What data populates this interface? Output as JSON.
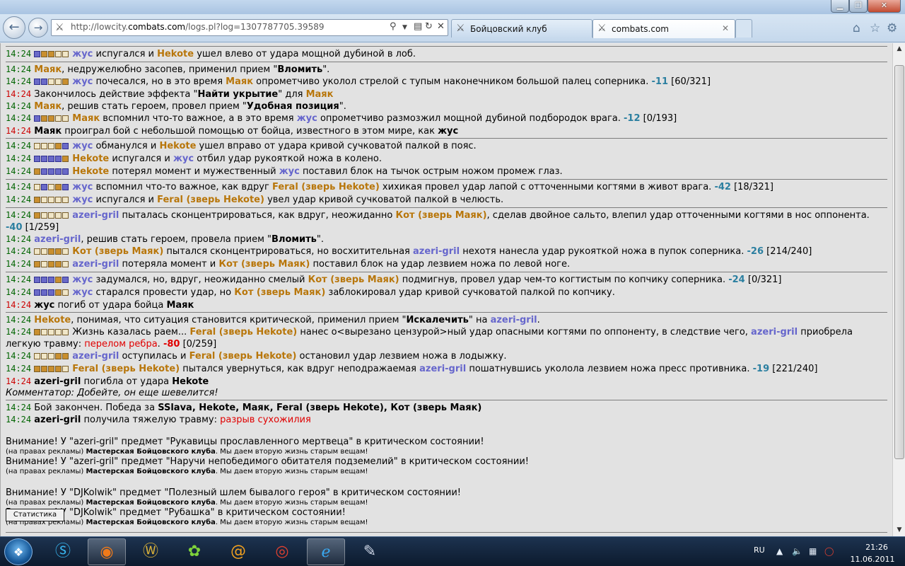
{
  "browser": {
    "url_prefix": "http://lowcity.",
    "url_domain": "combats.com",
    "url_suffix": "/logs.pl?log=1307787705.39589",
    "tabs": [
      {
        "label": "Бойцовский клуб"
      },
      {
        "label": "combats.com"
      }
    ],
    "close_glyph": "✕"
  },
  "log": {
    "l1": {
      "time": "14:24",
      "a": "жус",
      "t1": " испугался и ",
      "b": "Hekote",
      "t2": " ушел влево от удара мощной дубиной в лоб."
    },
    "l2": {
      "time": "14:24",
      "a": "Маяк",
      "t1": ", недружелюбно засопев, применил прием \"",
      "skill": "Вломить",
      "t2": "\"."
    },
    "l3": {
      "time": "14:24",
      "a": "жус",
      "t1": " почесался, но в это время ",
      "b": "Маяк",
      "t2": " опрометчиво уколол стрелой с тупым наконечником большой палец соперника. ",
      "dmg": "-11",
      "hp": " [60/321]"
    },
    "l4": {
      "time": "14:24",
      "t1": "Закончилось действие эффекта \"",
      "skill": "Найти укрытие",
      "t2": "\" для ",
      "a": "Маяк"
    },
    "l5": {
      "time": "14:24",
      "a": "Маяк",
      "t1": ", решив стать героем, провел прием \"",
      "skill": "Удобная позиция",
      "t2": "\"."
    },
    "l6": {
      "time": "14:24",
      "a": "Маяк",
      "t1": " вспомнил что-то важное, а в это время ",
      "b": "жус",
      "t2": " опрометчиво размозжил мощной дубиной подбородок врага. ",
      "dmg": "-12",
      "hp": " [0/193]"
    },
    "l7": {
      "time": "14:24",
      "a": "Маяк",
      "t1": " проиграл бой с небольшой помощью от бойца, известного в этом мире, как ",
      "b": "жус"
    },
    "l8": {
      "time": "14:24",
      "a": "жус",
      "t1": " обманулся и ",
      "b": "Hekote",
      "t2": " ушел вправо от удара кривой сучковатой палкой в пояс."
    },
    "l9": {
      "time": "14:24",
      "a": "Hekote",
      "t1": " испугался и ",
      "b": "жус",
      "t2": " отбил удар рукояткой ножа в колено."
    },
    "l10": {
      "time": "14:24",
      "a": "Hekote",
      "t1": " потерял момент и мужественный ",
      "b": "жус",
      "t2": " поставил блок на тычок острым ножом промеж глаз."
    },
    "l11": {
      "time": "14:24",
      "a": "жус",
      "t1": " вспомнил что-то важное, как вдруг ",
      "b": "Feral (зверь Hekote)",
      "t2": " хихикая провел удар лапой с отточенными когтями в живот врага. ",
      "dmg": "-42",
      "hp": " [18/321]"
    },
    "l12": {
      "time": "14:24",
      "a": "жус",
      "t1": " испугался и ",
      "b": "Feral (зверь Hekote)",
      "t2": " увел удар кривой сучковатой палкой в челюсть."
    },
    "l13": {
      "time": "14:24",
      "a": "azeri-gril",
      "t1": " пыталась сконцентрироваться, как вдруг, неожиданно ",
      "b": "Кот (зверь Маяк)",
      "t2": ", сделав двойное сальто, влепил удар отточенными когтями в нос оппонента. ",
      "dmg": "-40",
      "hp": " [1/259]"
    },
    "l14": {
      "time": "14:24",
      "a": "azeri-gril",
      "t1": ", решив стать героем, провела прием \"",
      "skill": "Вломить",
      "t2": "\"."
    },
    "l15": {
      "time": "14:24",
      "a": "Кот (зверь Маяк)",
      "t1": " пытался сконцентрироваться, но восхитительная ",
      "b": "azeri-gril",
      "t2": " нехотя нанесла удар рукояткой ножа в пупок соперника. ",
      "dmg": "-26",
      "hp": " [214/240]"
    },
    "l16": {
      "time": "14:24",
      "a": "azeri-gril",
      "t1": " потеряла момент и ",
      "b": "Кот (зверь Маяк)",
      "t2": " поставил блок на удар лезвием ножа по левой ноге."
    },
    "l17": {
      "time": "14:24",
      "a": "жус",
      "t1": " задумался, но, вдруг, неожиданно смелый ",
      "b": "Кот (зверь Маяк)",
      "t2": " подмигнув, провел удар чем-то когтистым по копчику соперника. ",
      "dmg": "-24",
      "hp": " [0/321]"
    },
    "l18": {
      "time": "14:24",
      "a": "жус",
      "t1": " старался провести удар, но ",
      "b": "Кот (зверь Маяк)",
      "t2": " заблокировал удар кривой сучковатой палкой по копчику."
    },
    "l19": {
      "time": "14:24",
      "a": "жус",
      "t1": " погиб от удара бойца ",
      "b": "Маяк"
    },
    "l20": {
      "time": "14:24",
      "a": "Hekote",
      "t1": ", понимая, что ситуация становится критической, применил прием \"",
      "skill": "Искалечить",
      "t2": "\" на ",
      "b": "azeri-gril",
      "t3": "."
    },
    "l21": {
      "time": "14:24",
      "t1": "Жизнь казалась раем... ",
      "a": "Feral (зверь Hekote)",
      "t2": " нанес о<вырезано цензурой>ный удар опасными когтями по оппоненту, в следствие чего, ",
      "b": "azeri-gril",
      "t3": " приобрела легкую травму: ",
      "trauma": "перелом ребра",
      "t4": ". ",
      "dmg": "-80",
      "hp": " [0/259]"
    },
    "l22": {
      "time": "14:24",
      "a": "azeri-gril",
      "t1": " оступилась и ",
      "b": "Feral (зверь Hekote)",
      "t2": " остановил удар лезвием ножа в лодыжку."
    },
    "l23": {
      "time": "14:24",
      "a": "Feral (зверь Hekote)",
      "t1": " пытался увернуться, как вдруг неподражаемая ",
      "b": "azeri-gril",
      "t2": " пошатнувшись уколола лезвием ножа пресс противника. ",
      "dmg": "-19",
      "hp": " [221/240]"
    },
    "l24": {
      "time": "14:24",
      "a": "azeri-gril",
      "t1": " погибла от удара ",
      "b": "Hekote"
    },
    "commentator": "Комментатор: Добейте, он еще шевелится!",
    "l25": {
      "time": "14:24",
      "t1": "Бой закончен. Победа за ",
      "winners": "SSlava, Hekote, Маяк, Feral (зверь Hekote), Кот (зверь Маяк)"
    },
    "l26": {
      "time": "14:24",
      "a": "azeri-gril",
      "t1": " получила тяжелую травму: ",
      "trauma": "разрыв сухожилия"
    }
  },
  "warnings": [
    {
      "text": "Внимание! У \"azeri-gril\" предмет \"Рукавицы прославленного мертвеца\" в критическом состоянии!"
    },
    {
      "text": "Внимание! У \"azeri-gril\" предмет \"Наручи непобедимого обитателя подземелий\" в критическом состоянии!"
    },
    {
      "text": "Внимание! У \"DJKolwik\" предмет \"Полезный шлем бывалого героя\" в критическом состоянии!"
    },
    {
      "text": "Внимание! У \"DJKolwik\" предмет \"Рубашка\" в критическом состоянии!"
    }
  ],
  "ad": {
    "prefix": "(на правах рекламы) ",
    "name": "Мастерская Бойцовского клуба",
    "tail": ". Мы даем вторую жизнь старым вещам!"
  },
  "stats_button": "Статистика",
  "scroll": {
    "position_fraction": 0.13,
    "visible_fraction": 0.84
  },
  "taskbar": {
    "lang": "RU",
    "time": "21:26",
    "date": "11.06.2011"
  }
}
